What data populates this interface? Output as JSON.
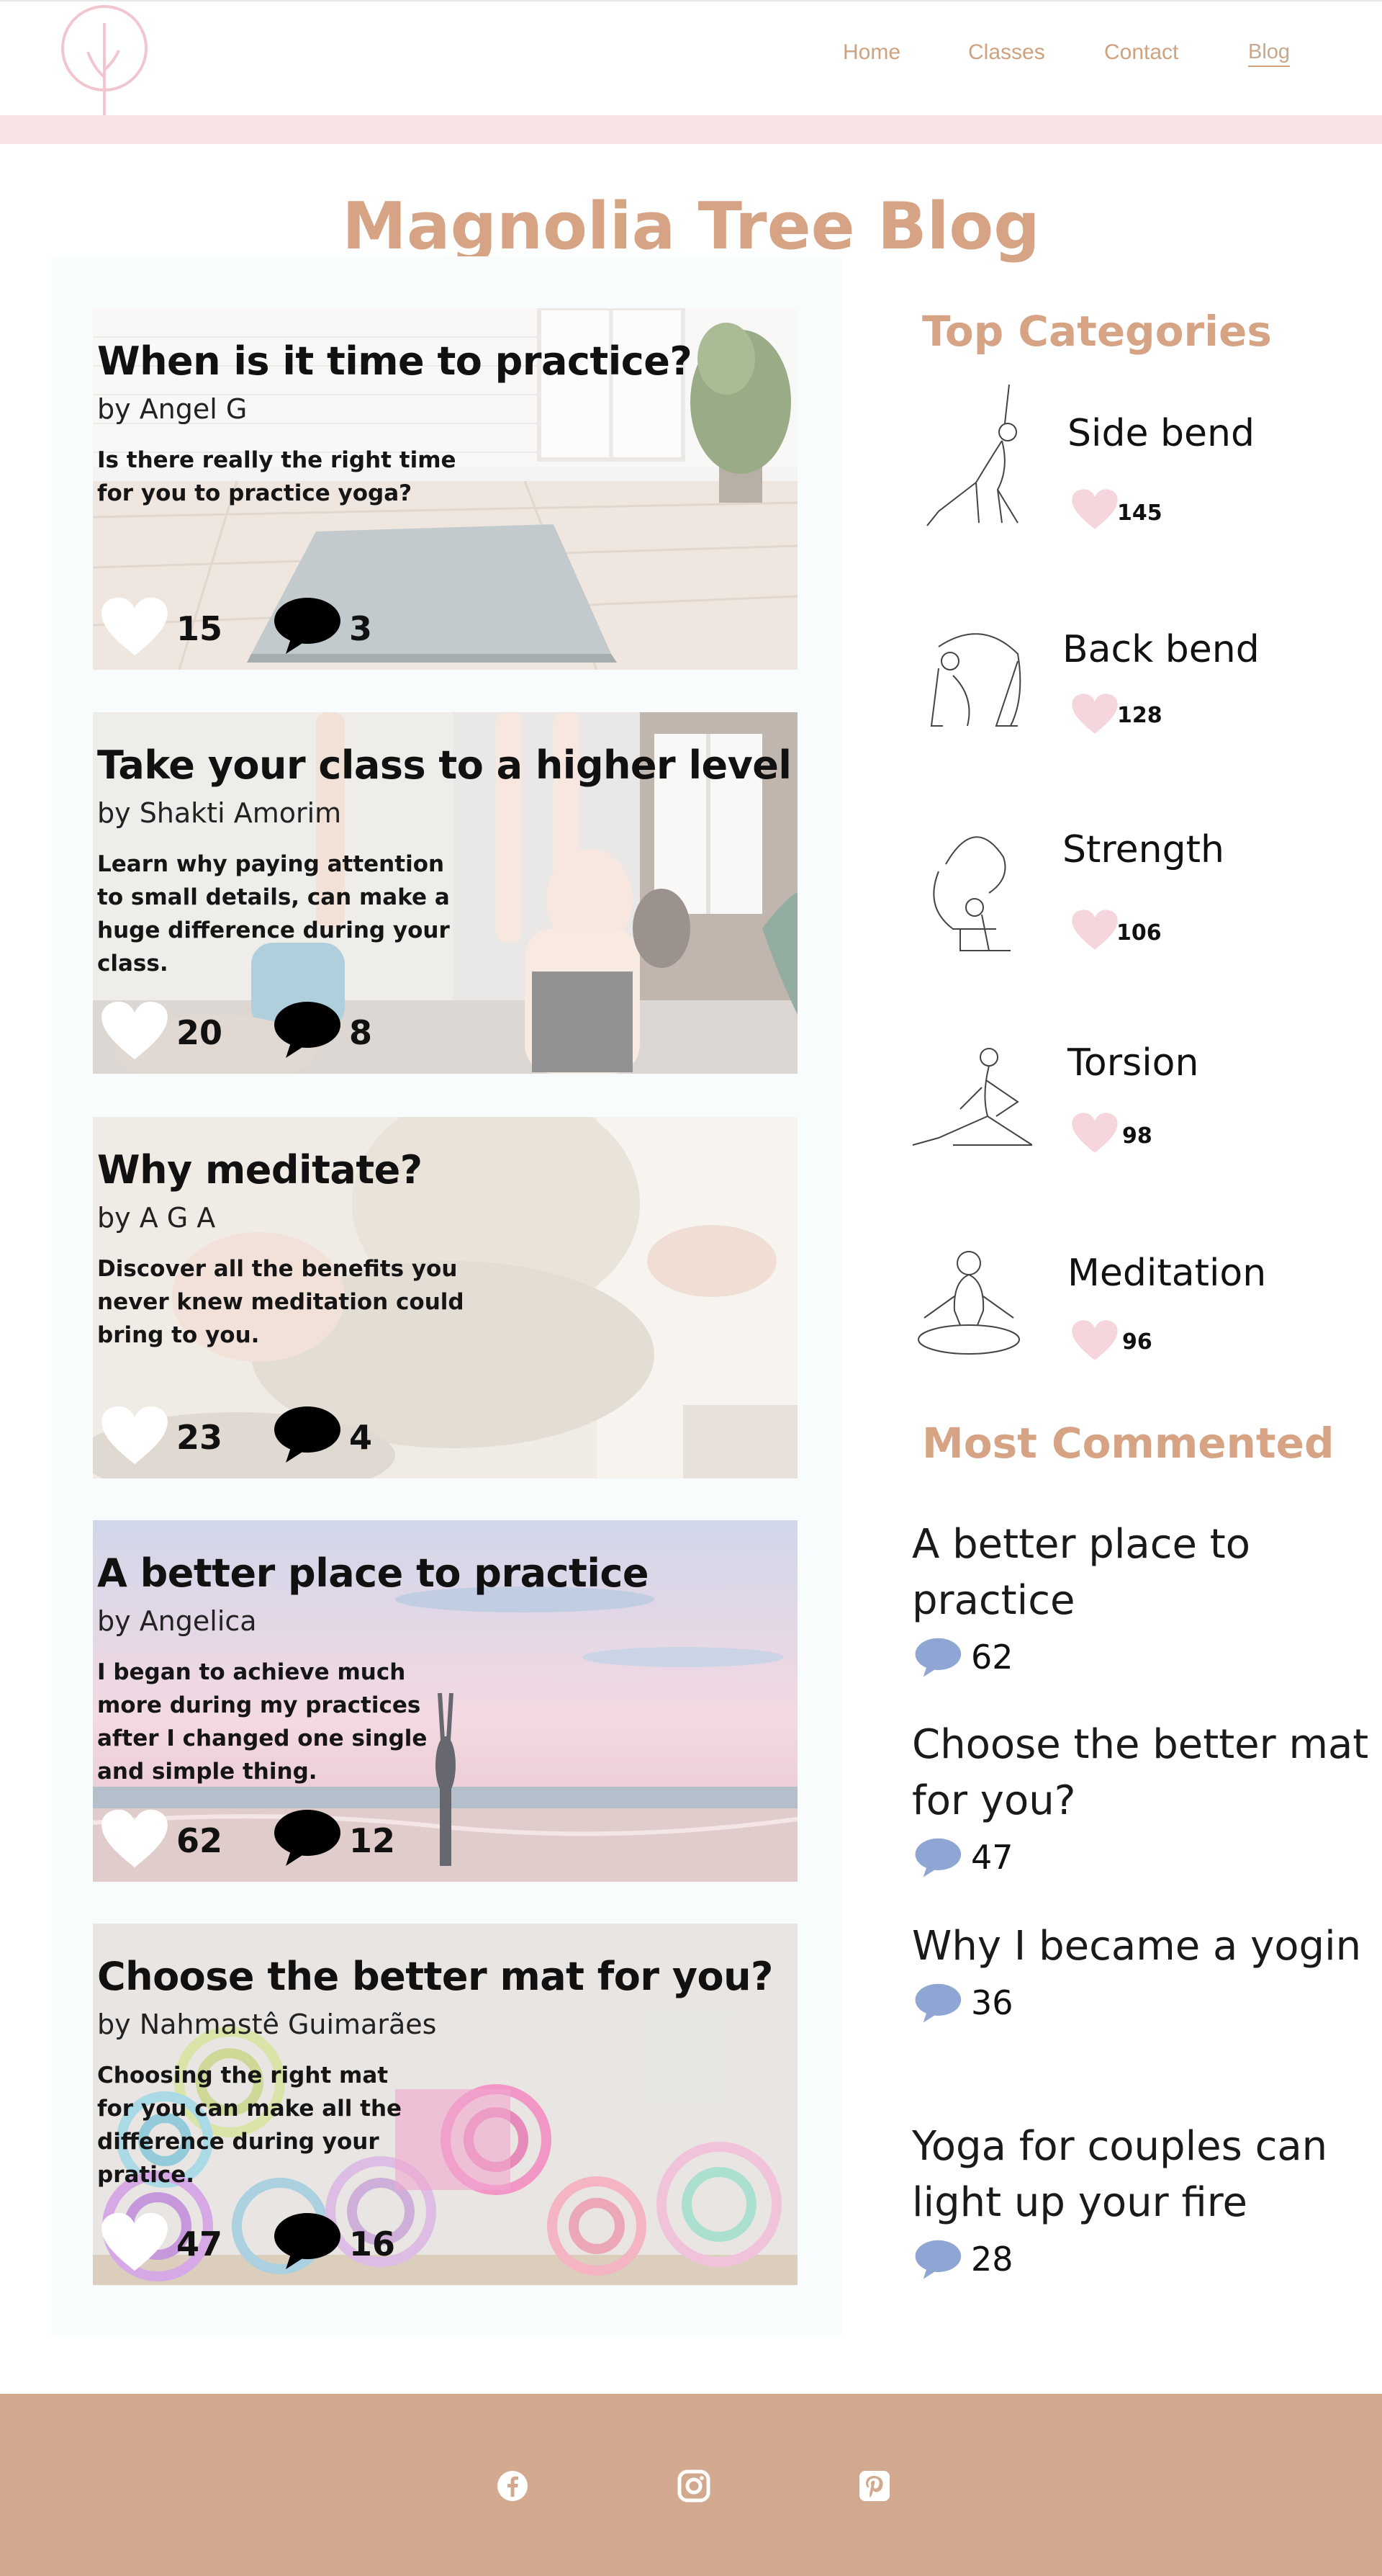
{
  "nav": {
    "items": [
      {
        "label": "Home"
      },
      {
        "label": "Classes"
      },
      {
        "label": "Contact"
      },
      {
        "label": "Blog",
        "active": true
      }
    ]
  },
  "page": {
    "title": "Magnolia Tree Blog"
  },
  "colors": {
    "accent": "#d6a384",
    "nav": "#cfa27f",
    "pink_band": "#f7e3e6",
    "footer": "#d2a98e",
    "category_heart": "#f4d6dc",
    "comment_bubble": "#8fa6d4"
  },
  "posts": [
    {
      "title": "When is it time to practice?",
      "author": "by Angel G",
      "excerpt": "Is there really the right time for you to practice yoga?",
      "likes": "15",
      "comments": "3"
    },
    {
      "title": "Take your class to a higher level",
      "author": "by Shakti Amorim",
      "excerpt": "Learn why paying attention to small details, can make a huge difference during your class.",
      "likes": "20",
      "comments": "8"
    },
    {
      "title": "Why meditate?",
      "author": "by A G A",
      "excerpt": "Discover all the benefits you never knew meditation could bring to you.",
      "likes": "23",
      "comments": "4"
    },
    {
      "title": "A better place to practice",
      "author": "by Angelica",
      "excerpt": "I began to achieve much more during my practices after I changed one single and simple thing.",
      "likes": "62",
      "comments": "12"
    },
    {
      "title": "Choose the better mat for you?",
      "author": "by Nahmastê Guimarães",
      "excerpt": "Choosing the right mat for you can make all the difference during your pratice.",
      "likes": "47",
      "comments": "16"
    }
  ],
  "sidebar": {
    "top_categories_heading": "Top Categories",
    "categories": [
      {
        "name": "Side bend",
        "count": "145"
      },
      {
        "name": "Back bend",
        "count": "128"
      },
      {
        "name": "Strength",
        "count": "106"
      },
      {
        "name": "Torsion",
        "count": "98"
      },
      {
        "name": "Meditation",
        "count": "96"
      }
    ],
    "most_commented_heading": "Most Commented",
    "most_commented": [
      {
        "title": "A better place to practice",
        "count": "62"
      },
      {
        "title": "Choose the better mat for you?",
        "count": "47"
      },
      {
        "title": "Why I became a yogin",
        "count": "36"
      },
      {
        "title": "Yoga for couples can light up your fire",
        "count": "28"
      }
    ]
  },
  "footer": {
    "icons": [
      "facebook-icon",
      "instagram-icon",
      "pinterest-icon"
    ]
  }
}
